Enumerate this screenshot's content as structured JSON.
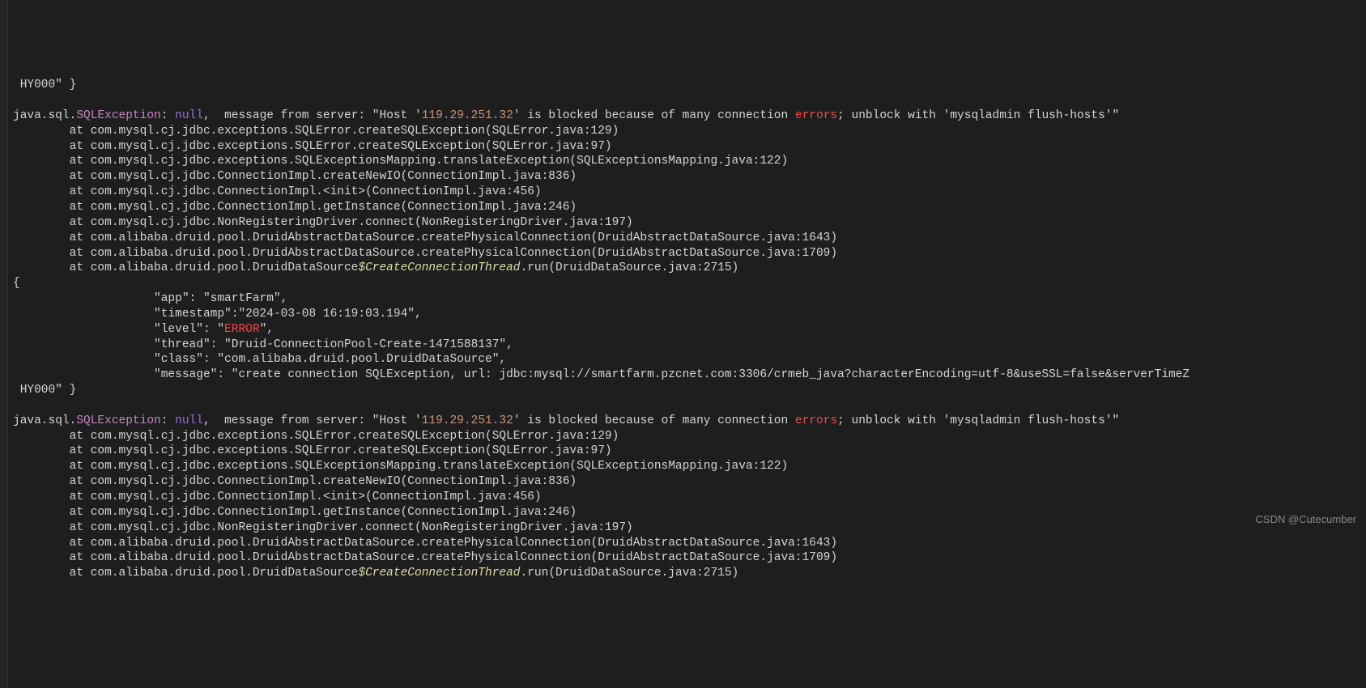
{
  "lines": [
    {
      "type": "plain",
      "indent": " ",
      "text": "HY000\" }"
    },
    {
      "type": "blank"
    },
    {
      "type": "exception",
      "indent": "",
      "prefix": "java.sql.",
      "excClass": "SQLException",
      "colon": ": ",
      "nullKw": "null",
      "mid": ",  message from server: \"Host '",
      "ip": "119.29.251.32",
      "mid2": "' is blocked because of many connection ",
      "errKw": "errors",
      "tail": "; unblock with 'mysqladmin flush-hosts'\""
    },
    {
      "type": "at",
      "text": "        at com.mysql.cj.jdbc.exceptions.SQLError.createSQLException(SQLError.java:129)"
    },
    {
      "type": "at",
      "text": "        at com.mysql.cj.jdbc.exceptions.SQLError.createSQLException(SQLError.java:97)"
    },
    {
      "type": "at",
      "text": "        at com.mysql.cj.jdbc.exceptions.SQLExceptionsMapping.translateException(SQLExceptionsMapping.java:122)"
    },
    {
      "type": "at",
      "text": "        at com.mysql.cj.jdbc.ConnectionImpl.createNewIO(ConnectionImpl.java:836)"
    },
    {
      "type": "at",
      "text": "        at com.mysql.cj.jdbc.ConnectionImpl.<init>(ConnectionImpl.java:456)"
    },
    {
      "type": "at",
      "text": "        at com.mysql.cj.jdbc.ConnectionImpl.getInstance(ConnectionImpl.java:246)"
    },
    {
      "type": "at",
      "text": "        at com.mysql.cj.jdbc.NonRegisteringDriver.connect(NonRegisteringDriver.java:197)"
    },
    {
      "type": "at",
      "text": "        at com.alibaba.druid.pool.DruidAbstractDataSource.createPhysicalConnection(DruidAbstractDataSource.java:1643)"
    },
    {
      "type": "at",
      "text": "        at com.alibaba.druid.pool.DruidAbstractDataSource.createPhysicalConnection(DruidAbstractDataSource.java:1709)"
    },
    {
      "type": "at-thread",
      "prefix": "        at com.alibaba.druid.pool.DruidDataSource",
      "thread": "$CreateConnectionThread",
      "suffix": ".run(DruidDataSource.java:2715)"
    },
    {
      "type": "plain",
      "indent": "",
      "text": "{"
    },
    {
      "type": "plain",
      "indent": "                    ",
      "text": "\"app\": \"smartFarm\","
    },
    {
      "type": "plain",
      "indent": "                    ",
      "text": "\"timestamp\":\"2024-03-08 16:19:03.194\","
    },
    {
      "type": "level",
      "indent": "                    ",
      "prefix": "\"level\": \"",
      "errKw": "ERROR",
      "suffix": "\","
    },
    {
      "type": "plain",
      "indent": "                    ",
      "text": "\"thread\": \"Druid-ConnectionPool-Create-1471588137\","
    },
    {
      "type": "plain",
      "indent": "                    ",
      "text": "\"class\": \"com.alibaba.druid.pool.DruidDataSource\","
    },
    {
      "type": "plain",
      "indent": "                    ",
      "text": "\"message\": \"create connection SQLException, url: jdbc:mysql://smartfarm.pzcnet.com:3306/crmeb_java?characterEncoding=utf-8&useSSL=false&serverTimeZ"
    },
    {
      "type": "plain",
      "indent": " ",
      "text": "HY000\" }"
    },
    {
      "type": "blank"
    },
    {
      "type": "exception",
      "indent": "",
      "prefix": "java.sql.",
      "excClass": "SQLException",
      "colon": ": ",
      "nullKw": "null",
      "mid": ",  message from server: \"Host '",
      "ip": "119.29.251.32",
      "mid2": "' is blocked because of many connection ",
      "errKw": "errors",
      "tail": "; unblock with 'mysqladmin flush-hosts'\""
    },
    {
      "type": "at",
      "text": "        at com.mysql.cj.jdbc.exceptions.SQLError.createSQLException(SQLError.java:129)"
    },
    {
      "type": "at",
      "text": "        at com.mysql.cj.jdbc.exceptions.SQLError.createSQLException(SQLError.java:97)"
    },
    {
      "type": "at",
      "text": "        at com.mysql.cj.jdbc.exceptions.SQLExceptionsMapping.translateException(SQLExceptionsMapping.java:122)"
    },
    {
      "type": "at",
      "text": "        at com.mysql.cj.jdbc.ConnectionImpl.createNewIO(ConnectionImpl.java:836)"
    },
    {
      "type": "at",
      "text": "        at com.mysql.cj.jdbc.ConnectionImpl.<init>(ConnectionImpl.java:456)"
    },
    {
      "type": "at",
      "text": "        at com.mysql.cj.jdbc.ConnectionImpl.getInstance(ConnectionImpl.java:246)"
    },
    {
      "type": "at",
      "text": "        at com.mysql.cj.jdbc.NonRegisteringDriver.connect(NonRegisteringDriver.java:197)"
    },
    {
      "type": "at",
      "text": "        at com.alibaba.druid.pool.DruidAbstractDataSource.createPhysicalConnection(DruidAbstractDataSource.java:1643)"
    },
    {
      "type": "at",
      "text": "        at com.alibaba.druid.pool.DruidAbstractDataSource.createPhysicalConnection(DruidAbstractDataSource.java:1709)"
    },
    {
      "type": "at-thread",
      "prefix": "        at com.alibaba.druid.pool.DruidDataSource",
      "thread": "$CreateConnectionThread",
      "suffix": ".run(DruidDataSource.java:2715)"
    }
  ],
  "watermark": "CSDN @Cutecumber"
}
